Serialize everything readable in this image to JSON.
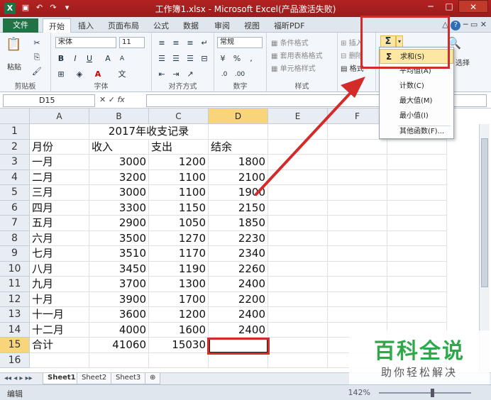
{
  "window": {
    "title": "工作簿1.xlsx - Microsoft Excel(产品激活失败)",
    "app_icon": "X",
    "qat": [
      "save-icon",
      "undo-icon",
      "redo-icon",
      "customize-icon"
    ]
  },
  "ribbon_tabs": {
    "file": "文件",
    "tabs": [
      "开始",
      "插入",
      "页面布局",
      "公式",
      "数据",
      "审阅",
      "视图",
      "福昕PDF"
    ],
    "active": "开始"
  },
  "ribbon": {
    "clipboard": {
      "label": "剪贴板",
      "paste": "粘贴"
    },
    "font": {
      "label": "字体",
      "font_name": "宋体",
      "font_size": "11",
      "bold": "B",
      "italic": "I",
      "underline": "U"
    },
    "alignment": {
      "label": "对齐方式"
    },
    "number": {
      "label": "数字",
      "format": "常规"
    },
    "styles": {
      "label": "样式",
      "conditional": "条件格式",
      "table": "套用表格格式",
      "cell": "单元格样式"
    },
    "cells": {
      "insert": "插入",
      "delete": "删除",
      "format": "格式"
    },
    "editing": {
      "autosum": "Σ",
      "sort_filter": "选择"
    }
  },
  "autosum_menu": {
    "items": [
      {
        "icon": "Σ",
        "label": "求和(S)"
      },
      {
        "icon": "",
        "label": "平均值(A)"
      },
      {
        "icon": "",
        "label": "计数(C)"
      },
      {
        "icon": "",
        "label": "最大值(M)"
      },
      {
        "icon": "",
        "label": "最小值(I)"
      },
      {
        "icon": "",
        "label": "其他函数(F)..."
      }
    ]
  },
  "formula_bar": {
    "name_box": "D15",
    "fx": "fx",
    "formula": ""
  },
  "sheet": {
    "columns": [
      "A",
      "B",
      "C",
      "D",
      "E",
      "F",
      "G"
    ],
    "title": "2017年收支记录",
    "headers": [
      "月份",
      "收入",
      "支出",
      "结余"
    ],
    "rows": [
      [
        "一月",
        "3000",
        "1200",
        "1800"
      ],
      [
        "二月",
        "3200",
        "1100",
        "2100"
      ],
      [
        "三月",
        "3000",
        "1100",
        "1900"
      ],
      [
        "四月",
        "3300",
        "1150",
        "2150"
      ],
      [
        "五月",
        "2900",
        "1050",
        "1850"
      ],
      [
        "六月",
        "3500",
        "1270",
        "2230"
      ],
      [
        "七月",
        "3510",
        "1170",
        "2340"
      ],
      [
        "八月",
        "3450",
        "1190",
        "2260"
      ],
      [
        "九月",
        "3700",
        "1300",
        "2400"
      ],
      [
        "十月",
        "3900",
        "1700",
        "2200"
      ],
      [
        "十一月",
        "3600",
        "1200",
        "2400"
      ],
      [
        "十二月",
        "4000",
        "1600",
        "2400"
      ]
    ],
    "total": [
      "合计",
      "41060",
      "15030",
      ""
    ],
    "row_numbers": [
      "1",
      "2",
      "3",
      "4",
      "5",
      "6",
      "7",
      "8",
      "9",
      "10",
      "11",
      "12",
      "13",
      "14",
      "15",
      "16"
    ]
  },
  "sheet_tabs": [
    "Sheet1",
    "Sheet2",
    "Sheet3"
  ],
  "status": {
    "mode": "编辑",
    "zoom": "142%"
  },
  "watermark": {
    "brand": "百科全说",
    "tagline": "助你轻松解决"
  },
  "colors": {
    "title_bar": "#b22222",
    "file_tab": "#217346",
    "highlight": "#d32a2a",
    "selected_header": "#f8d57a",
    "menu_hover": "#fde7a2",
    "watermark_green": "#2ea84a"
  }
}
